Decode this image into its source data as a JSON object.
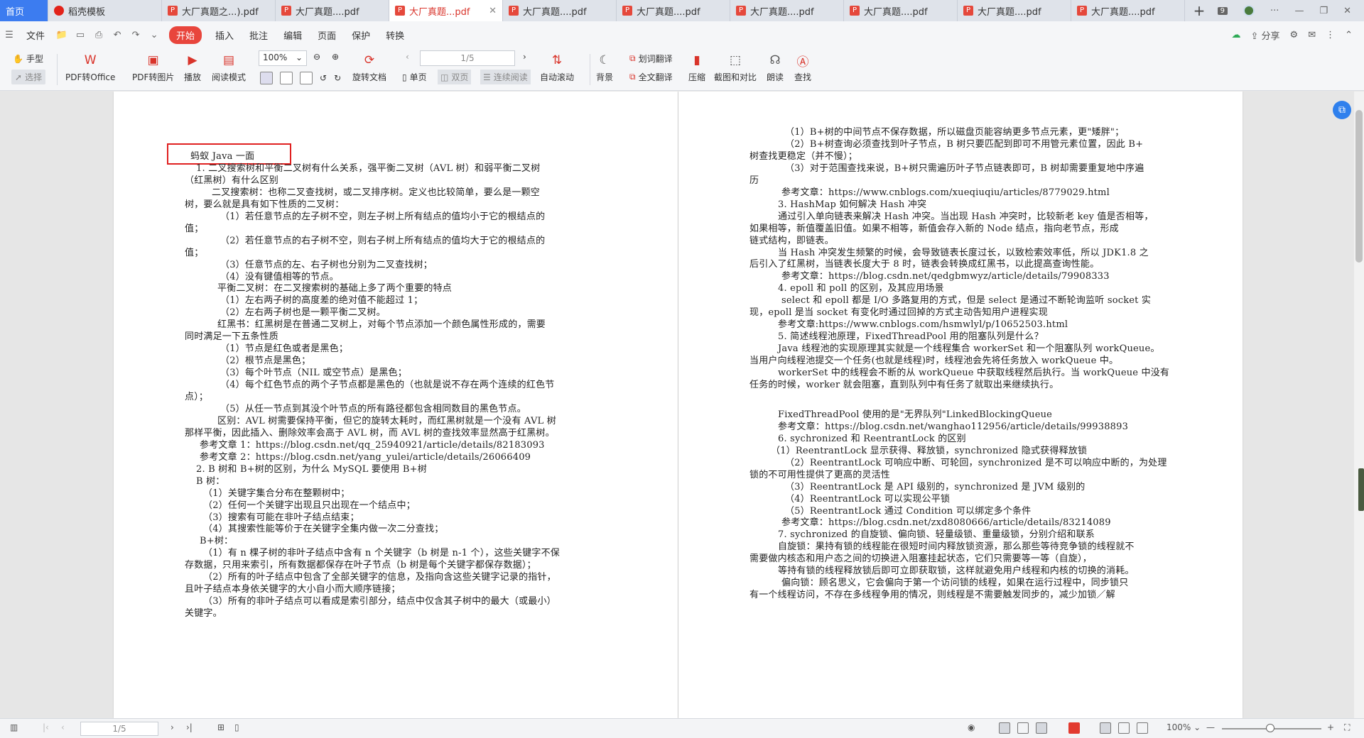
{
  "tabs": [
    {
      "label": "首页",
      "kind": "home"
    },
    {
      "label": "稻壳模板",
      "kind": "shell"
    },
    {
      "label": "大厂真题之...).pdf",
      "kind": "pdf"
    },
    {
      "label": "大厂真题....pdf",
      "kind": "pdf"
    },
    {
      "label": "大厂真题...pdf",
      "kind": "pdf",
      "active": true
    },
    {
      "label": "大厂真题....pdf",
      "kind": "pdf"
    },
    {
      "label": "大厂真题....pdf",
      "kind": "pdf"
    },
    {
      "label": "大厂真题....pdf",
      "kind": "pdf"
    },
    {
      "label": "大厂真题....pdf",
      "kind": "pdf"
    },
    {
      "label": "大厂真题....pdf",
      "kind": "pdf"
    },
    {
      "label": "大厂真题....pdf",
      "kind": "pdf"
    }
  ],
  "titlebar": {
    "new_tab": "+",
    "badge": "9"
  },
  "menu": {
    "file": "文件",
    "items": [
      "开始",
      "插入",
      "批注",
      "编辑",
      "页面",
      "保护",
      "转换"
    ],
    "active": "开始",
    "share": "分享"
  },
  "toolbar": {
    "hand": "手型",
    "select": "选择",
    "pdf_to_office": "PDF转Office",
    "pdf_to_image": "PDF转图片",
    "play": "播放",
    "read_mode": "阅读模式",
    "zoom": "100%",
    "rotate": "旋转文档",
    "page_input": "1/5",
    "single": "单页",
    "double": "双页",
    "continuous": "连续阅读",
    "auto_scroll": "自动滚动",
    "background": "背景",
    "word_translate": "划词翻译",
    "full_translate": "全文翻译",
    "compress": "压缩",
    "screenshot": "截图和对比",
    "read_aloud": "朗读",
    "find": "查找"
  },
  "left_page_lines": [
    "蚂蚁 Java 一面",
    "1.   二叉搜索树和平衡二叉树有什么关系，强平衡二叉树（AVL 树）和弱平衡二叉树",
    "（红黑树）有什么区别",
    "二叉搜索树：也称二叉查找树，或二叉排序树。定义也比较简单，要么是一颗空",
    "树，要么就是具有如下性质的二叉树：",
    "（1）若任意节点的左子树不空，则左子树上所有结点的值均小于它的根结点的",
    "值；",
    "（2）若任意节点的右子树不空，则右子树上所有结点的值均大于它的根结点的",
    "值；",
    "（3）任意节点的左、右子树也分别为二叉查找树；",
    "（4）没有键值相等的节点。",
    "平衡二叉树：在二叉搜索树的基础上多了两个重要的特点",
    "（1）左右两子树的高度差的绝对值不能超过 1；",
    "（2）左右两子树也是一颗平衡二叉树。",
    "红黑书：红黑树是在普通二叉树上，对每个节点添加一个颜色属性形成的，需要",
    "同时满足一下五条性质",
    "（1）节点是红色或者是黑色；",
    "（2）根节点是黑色；",
    "（3）每个叶节点（NIL 或空节点）是黑色；",
    "（4）每个红色节点的两个子节点都是黑色的（也就是说不存在两个连续的红色节",
    "点）；",
    "（5）从任一节点到其没个叶节点的所有路径都包含相同数目的黑色节点。",
    "区别：AVL 树需要保持平衡，但它的旋转太耗时，而红黑树就是一个没有 AVL 树",
    "那样平衡，因此插入、删除效率会高于 AVL 树，而 AVL 树的查找效率显然高于红黑树。",
    "参考文章 1：https://blog.csdn.net/qq_25940921/article/details/82183093",
    "参考文章 2：https://blog.csdn.net/yang_yulei/article/details/26066409",
    "2.  B 树和 B+树的区别，为什么 MySQL 要使用 B+树",
    "B 树：",
    "（1）关键字集合分布在整颗树中；",
    "（2）任何一个关键字出现且只出现在一个结点中；",
    "（3）搜索有可能在非叶子结点结束；",
    "（4）其搜索性能等价于在关键字全集内做一次二分查找；",
    "B+树：",
    "（1）有 n 棵子树的非叶子结点中含有 n 个关键字（b 树是 n-1 个），这些关键字不保",
    "存数据，只用来索引，所有数据都保存在叶子节点（b 树是每个关键字都保存数据）；",
    "（2）所有的叶子结点中包含了全部关键字的信息，及指向含这些关键字记录的指针，",
    "且叶子结点本身依关键字的大小自小而大顺序链接；",
    "（3）所有的非叶子结点可以看成是索引部分，结点中仅含其子树中的最大（或最小）",
    "关键字。"
  ],
  "right_page_lines": [
    "（1）B+树的中间节点不保存数据，所以磁盘页能容纳更多节点元素，更\"矮胖\"；",
    "（2）B+树查询必须查找到叶子节点，B 树只要匹配到即可不用管元素位置，因此 B+",
    "树查找更稳定（并不慢）；",
    "（3）对于范围查找来说，B+树只需遍历叶子节点链表即可，B 树却需要重复地中序遍",
    "历",
    "参考文章：https://www.cnblogs.com/xueqiuqiu/articles/8779029.html",
    "3.  HashMap 如何解决 Hash 冲突",
    "通过引入单向链表来解决 Hash 冲突。当出现 Hash 冲突时，比较新老 key 值是否相等，",
    "如果相等，新值覆盖旧值。如果不相等，新值会存入新的 Node 结点，指向老节点，形成",
    "链式结构，即链表。",
    "当 Hash 冲突发生频繁的时候，会导致链表长度过长，以致检索效率低，所以 JDK1.8 之",
    "后引入了红黑树，当链表长度大于 8 时，链表会转换成红黑书，以此提高查询性能。",
    "参考文章：https://blog.csdn.net/qedgbmwyz/article/details/79908333",
    "4.  epoll 和 poll 的区别，及其应用场景",
    "select 和 epoll 都是 I/O 多路复用的方式，但是 select 是通过不断轮询监听 socket 实",
    "现，epoll 是当 socket 有变化时通过回掉的方式主动告知用户进程实现",
    "参考文章:https://www.cnblogs.com/hsmwlyl/p/10652503.html",
    "5.  简述线程池原理，FixedThreadPool 用的阻塞队列是什么？",
    "Java 线程池的实现原理其实就是一个线程集合 workerSet 和一个阻塞队列 workQueue。",
    "当用户向线程池提交一个任务(也就是线程)时，线程池会先将任务放入 workQueue 中。",
    "workerSet 中的线程会不断的从 workQueue 中获取线程然后执行。当 workQueue 中没有",
    "任务的时候，worker 就会阻塞，直到队列中有任务了就取出来继续执行。",
    "",
    "FixedThreadPool 使用的是\"无界队列\"LinkedBlockingQueue",
    "参考文章：https://blog.csdn.net/wanghao112956/article/details/99938893",
    "6.  sychronized 和 ReentrantLock 的区别",
    "（1）ReentrantLock 显示获得、释放锁，synchronized 隐式获得释放锁",
    "（2）ReentrantLock 可响应中断、可轮回，synchronized 是不可以响应中断的，为处理",
    "锁的不可用性提供了更高的灵活性",
    "（3）ReentrantLock 是 API 级别的，synchronized 是 JVM 级别的",
    "（4）ReentrantLock 可以实现公平锁",
    "（5）ReentrantLock 通过 Condition 可以绑定多个条件",
    "参考文章：https://blog.csdn.net/zxd8080666/article/details/83214089",
    "7.  sychronized 的自旋锁、偏向锁、轻量级锁、重量级锁，分别介绍和联系",
    "自旋锁：果持有锁的线程能在很短时间内释放锁资源，那么那些等待竞争锁的线程就不",
    "需要做内核态和用户态之间的切换进入阻塞挂起状态，它们只需要等一等（自旋），",
    "等持有锁的线程释放锁后即可立即获取锁，这样就避免用户线程和内核的切换的消耗。",
    "偏向锁：顾名思义，它会偏向于第一个访问锁的线程，如果在运行过程中，同步锁只",
    "有一个线程访问，不存在多线程争用的情况，则线程是不需要触发同步的，减少加锁／解"
  ],
  "status": {
    "page_input": "1/5",
    "zoom": "100%"
  },
  "colors": {
    "accent": "#e8453c",
    "home_tab": "#3c7cf0"
  }
}
